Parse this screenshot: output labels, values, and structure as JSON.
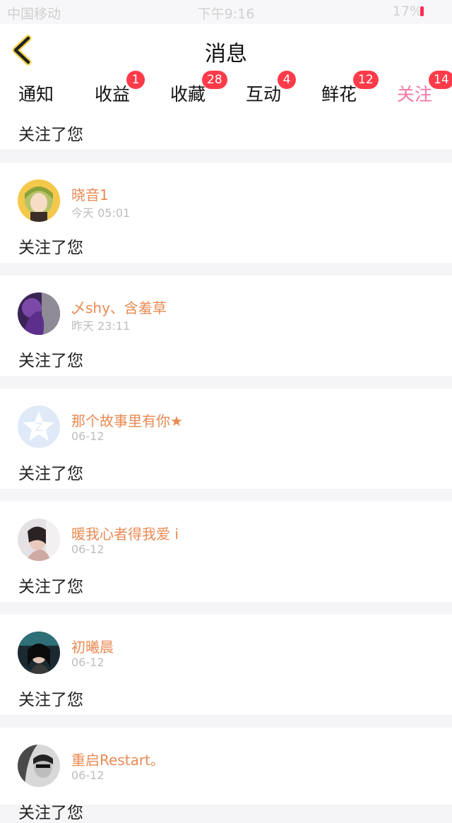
{
  "status_bar": {
    "carrier": "中国移动",
    "time": "下午9:16",
    "battery": "17%"
  },
  "nav": {
    "title": "消息"
  },
  "tabs": [
    {
      "label": "通知",
      "badge": ""
    },
    {
      "label": "收益",
      "badge": "1"
    },
    {
      "label": "收藏",
      "badge": "28"
    },
    {
      "label": "互动",
      "badge": "4"
    },
    {
      "label": "鲜花",
      "badge": "12"
    },
    {
      "label": "关注",
      "badge": "14",
      "active": true
    }
  ],
  "messages": [
    {
      "name": "",
      "time": "",
      "action": "关注了您"
    },
    {
      "name": "晓音1",
      "time": "今天 05:01",
      "action": "关注了您"
    },
    {
      "name": "乄shy、含羞草",
      "time": "昨天 23:11",
      "action": "关注了您"
    },
    {
      "name": "那个故事里有你★",
      "time": "06-12",
      "action": "关注了您"
    },
    {
      "name": "暖我心者得我爱 i",
      "time": "06-12",
      "action": "关注了您"
    },
    {
      "name": "初曦晨",
      "time": "06-12",
      "action": "关注了您"
    },
    {
      "name": "重启Restart。",
      "time": "06-12",
      "action": "关注了您"
    }
  ],
  "colors": {
    "accent": "#f277a6",
    "username": "#ea8a52",
    "badge": "#ff3b4a"
  }
}
